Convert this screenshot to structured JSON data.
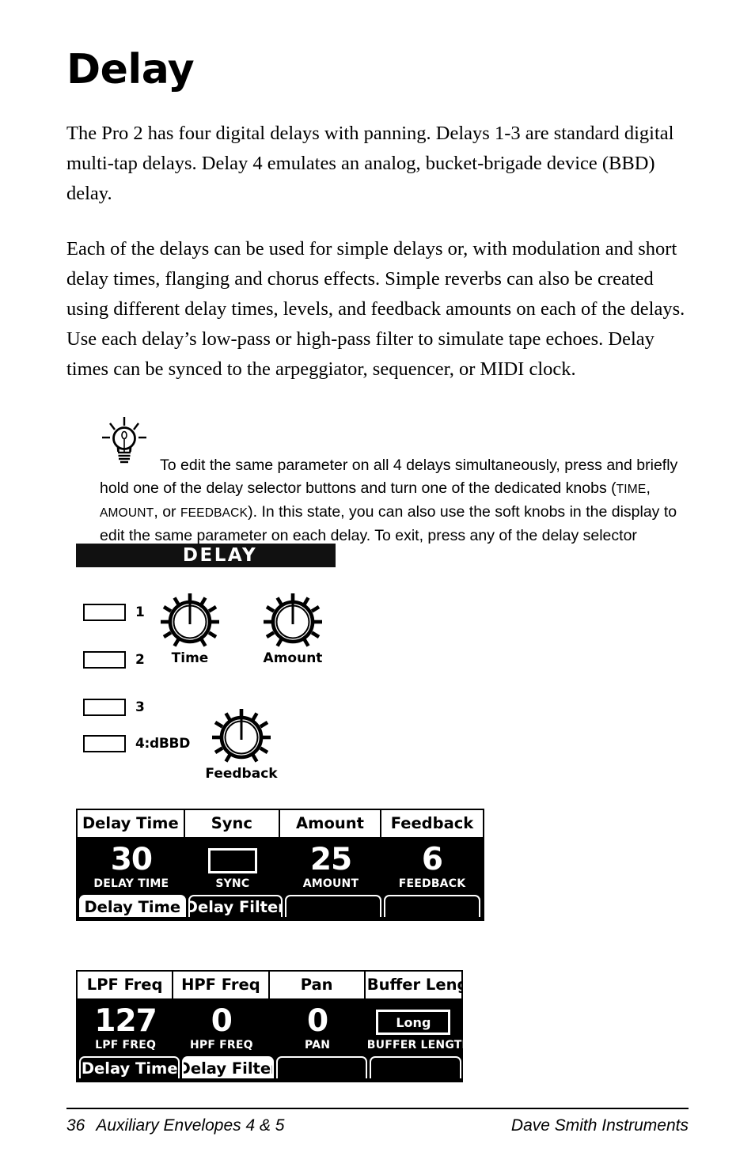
{
  "document": {
    "title": "Delay",
    "paragraphs": [
      "The Pro 2 has four digital delays with panning. Delays 1-3 are standard digital multi-tap delays. Delay 4 emulates an analog, bucket-brigade device (BBD) delay.",
      "Each of the delays can be used for simple delays or, with modulation and short delay times, flanging and chorus effects. Simple reverbs can also be created using different delay times, levels, and feedback amounts on each of the delays. Use each delay’s low-pass or high-pass filter to simulate tape echoes. Delay times can be synced to the arpeggiator, sequencer, or MIDI clock."
    ]
  },
  "tip": {
    "icon": "lightbulb-icon",
    "segments": {
      "s1": "To edit the same parameter on all 4 delays simultaneously, press and briefly hold one of the delay selector buttons and turn one of the dedicated knobs (",
      "sc1": "TIME",
      "s2": ", ",
      "sc2": "AMOUNT",
      "s3": ", or ",
      "sc3": "FEEDBACK",
      "s4": "). In this state, you can also use the soft knobs in the display to edit the same parameter on each delay. To exit, press any of the delay selector buttons."
    }
  },
  "hardware_panel": {
    "header": "DELAY",
    "selector_buttons": [
      {
        "label": "1"
      },
      {
        "label": "2"
      },
      {
        "label": "3"
      },
      {
        "label": "4:dBBD"
      }
    ],
    "knobs": [
      {
        "label": "Time",
        "name": "time-knob"
      },
      {
        "label": "Amount",
        "name": "amount-knob"
      },
      {
        "label": "Feedback",
        "name": "feedback-knob"
      }
    ]
  },
  "display_panels": [
    {
      "name": "delay-time-display",
      "headers": [
        "Delay Time",
        "Sync",
        "Amount",
        "Feedback"
      ],
      "header_widths": [
        "26.5%",
        "23.5%",
        "25%",
        "25%"
      ],
      "values": [
        {
          "type": "number",
          "value": "30",
          "caption": "DELAY TIME"
        },
        {
          "type": "box",
          "value": "",
          "caption": "SYNC"
        },
        {
          "type": "number",
          "value": "25",
          "caption": "AMOUNT"
        },
        {
          "type": "number",
          "value": "6",
          "caption": "FEEDBACK"
        }
      ],
      "tabs": [
        {
          "label": "Delay Time",
          "active": true
        },
        {
          "label": "Delay Filter",
          "active": false
        },
        {
          "label": "",
          "active": false
        },
        {
          "label": "",
          "active": false
        }
      ]
    },
    {
      "name": "delay-filter-display",
      "headers": [
        "LPF Freq",
        "HPF Freq",
        "Pan",
        "Buffer Length"
      ],
      "header_widths": [
        "25%",
        "25%",
        "25%",
        "25%"
      ],
      "values": [
        {
          "type": "number",
          "value": "127",
          "caption": "LPF FREQ"
        },
        {
          "type": "number",
          "value": "0",
          "caption": "HPF FREQ"
        },
        {
          "type": "number",
          "value": "0",
          "caption": "PAN"
        },
        {
          "type": "textbox",
          "value": "Long",
          "caption": "BUFFER LENGTH"
        }
      ],
      "tabs": [
        {
          "label": "Delay Time",
          "active": false
        },
        {
          "label": "Delay Filter",
          "active": true
        },
        {
          "label": "",
          "active": false
        },
        {
          "label": "",
          "active": false
        }
      ]
    }
  ],
  "footer": {
    "page_number": "36",
    "section": "Auxiliary Envelopes 4 & 5",
    "company": "Dave Smith Instruments"
  },
  "colors": {
    "ink": "#000000",
    "paper": "#ffffff",
    "panel_header": "#111111"
  }
}
